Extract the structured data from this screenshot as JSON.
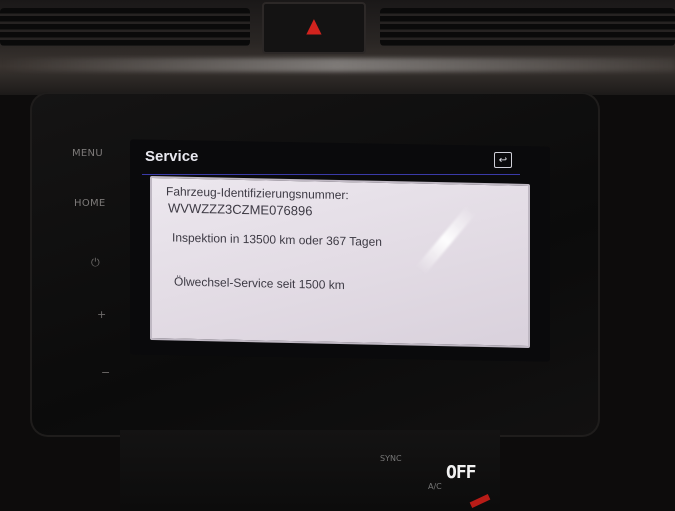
{
  "head_unit": {
    "menu_label": "MENU",
    "home_label": "HOME"
  },
  "screen": {
    "title": "Service",
    "vin_label": "Fahrzeug-Identifizierungsnummer:",
    "vin_value": "WVWZZZ3CZME076896",
    "inspection_text": "Inspektion in 13500 km oder 367 Tagen",
    "oil_service_text": "Ölwechsel-Service seit 1500 km"
  },
  "climate": {
    "sync_label": "SYNC",
    "ac_label": "A/C",
    "display": "OFF"
  },
  "colors": {
    "hazard": "#d2231e",
    "header_line": "#3a3aa8",
    "panel": "#e6e0e8"
  }
}
